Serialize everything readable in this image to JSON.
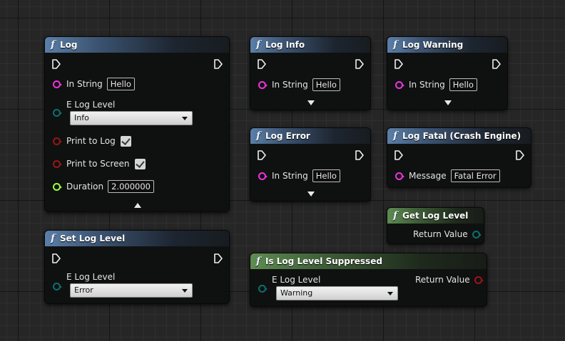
{
  "nodes": {
    "log": {
      "title": "Log",
      "in_string_label": "In String",
      "in_string_value": "Hello",
      "log_level_label": "E Log Level",
      "log_level_value": "Info",
      "print_to_log_label": "Print to Log",
      "print_to_log_checked": true,
      "print_to_screen_label": "Print to Screen",
      "print_to_screen_checked": true,
      "duration_label": "Duration",
      "duration_value": "2.000000"
    },
    "log_info": {
      "title": "Log Info",
      "in_string_label": "In String",
      "in_string_value": "Hello"
    },
    "log_warning": {
      "title": "Log Warning",
      "in_string_label": "In String",
      "in_string_value": "Hello"
    },
    "log_error": {
      "title": "Log Error",
      "in_string_label": "In String",
      "in_string_value": "Hello"
    },
    "log_fatal": {
      "title": "Log Fatal (Crash Engine)",
      "message_label": "Message",
      "message_value": "Fatal Error"
    },
    "get_log_level": {
      "title": "Get Log Level",
      "return_label": "Return Value"
    },
    "set_log_level": {
      "title": "Set Log Level",
      "log_level_label": "E Log Level",
      "log_level_value": "Error"
    },
    "is_suppressed": {
      "title": "Is Log Level Suppressed",
      "log_level_label": "E Log Level",
      "log_level_value": "Warning",
      "return_label": "Return Value"
    }
  },
  "icons": {
    "function": "f",
    "exec_pin": "exec-pin-icon",
    "expand": "chevron-icon"
  },
  "colors": {
    "pin_string": "#ee33dd",
    "pin_enum": "#0d6f6a",
    "pin_bool": "#9a1515",
    "pin_float": "#9dff38",
    "header_function": "#5b7fa8",
    "header_pure": "#5e8c52"
  }
}
